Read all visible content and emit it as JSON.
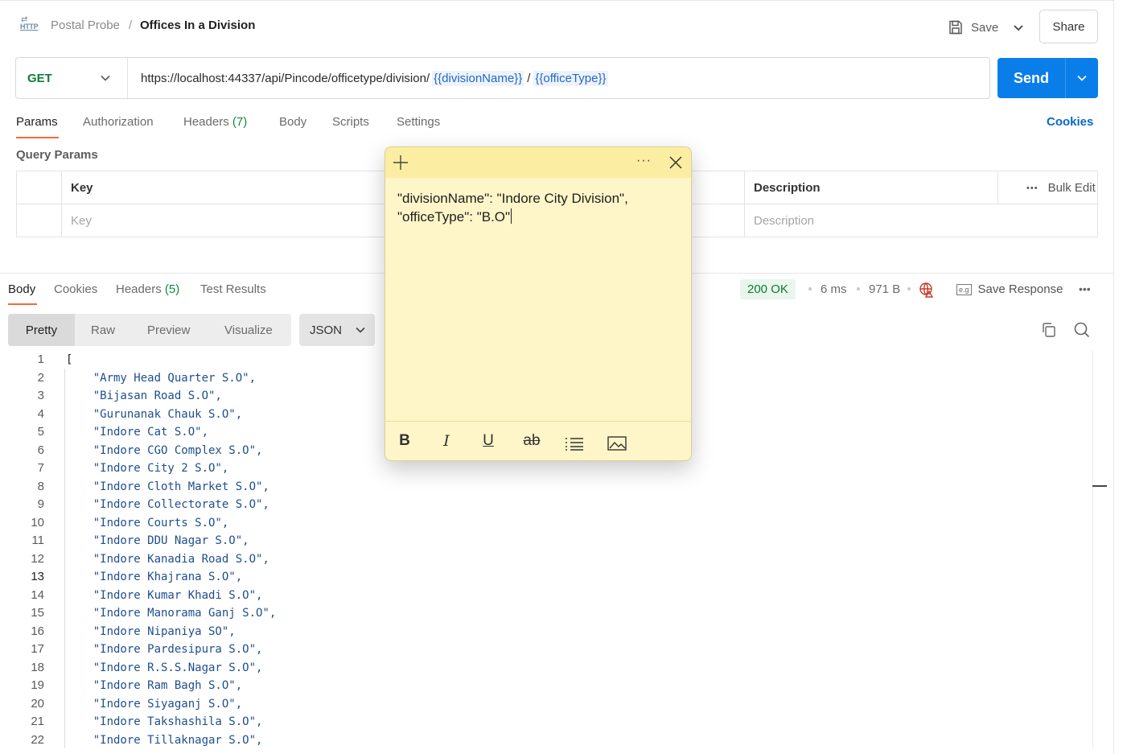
{
  "header": {
    "collection": "Postal Probe",
    "separator": "/",
    "request_name": "Offices In a Division",
    "save_label": "Save",
    "share_label": "Share"
  },
  "request": {
    "method": "GET",
    "url_base": "https://localhost:44337/api/Pincode/officetype/division/",
    "url_var1": "{{divisionName}}",
    "url_sep": "/",
    "url_var2": "{{officeType}}",
    "send_label": "Send"
  },
  "request_tabs": {
    "params": "Params",
    "authorization": "Authorization",
    "headers": "Headers",
    "headers_count": "(7)",
    "body": "Body",
    "scripts": "Scripts",
    "settings": "Settings",
    "cookies": "Cookies"
  },
  "query_params": {
    "title": "Query Params",
    "col_key": "Key",
    "col_description": "Description",
    "bulk_edit": "Bulk Edit",
    "key_placeholder": "Key",
    "description_placeholder": "Description"
  },
  "response": {
    "tabs": {
      "body": "Body",
      "cookies": "Cookies",
      "headers": "Headers",
      "headers_count": "(5)",
      "test_results": "Test Results"
    },
    "status": "200 OK",
    "time": "6 ms",
    "size": "971 B",
    "save_response": "Save Response",
    "view_modes": [
      "Pretty",
      "Raw",
      "Preview",
      "Visualize"
    ],
    "format": "JSON",
    "lines": [
      "[",
      "    \"Army Head Quarter S.O\",",
      "    \"Bijasan Road S.O\",",
      "    \"Gurunanak Chauk S.O\",",
      "    \"Indore Cat S.O\",",
      "    \"Indore CGO Complex S.O\",",
      "    \"Indore City 2 S.O\",",
      "    \"Indore Cloth Market S.O\",",
      "    \"Indore Collectorate S.O\",",
      "    \"Indore Courts S.O\",",
      "    \"Indore DDU Nagar S.O\",",
      "    \"Indore Kanadia Road S.O\",",
      "    \"Indore Khajrana S.O\",",
      "    \"Indore Kumar Khadi S.O\",",
      "    \"Indore Manorama Ganj S.O\",",
      "    \"Indore Nipaniya SO\",",
      "    \"Indore Pardesipura S.O\",",
      "    \"Indore R.S.S.Nagar S.O\",",
      "    \"Indore Ram Bagh S.O\",",
      "    \"Indore Siyaganj S.O\",",
      "    \"Indore Takshashila S.O\",",
      "    \"Indore Tillaknagar S.O\","
    ],
    "line_numbers": [
      "1",
      "2",
      "3",
      "4",
      "5",
      "6",
      "7",
      "8",
      "9",
      "10",
      "11",
      "12",
      "13",
      "14",
      "15",
      "16",
      "17",
      "18",
      "19",
      "20",
      "21",
      "22"
    ]
  },
  "sticky_note": {
    "line1": "\"divisionName\": \"Indore City Division\",",
    "line2": "\"officeType\": \"B.O\""
  },
  "colors": {
    "accent_orange": "#f26b3a",
    "send_blue": "#0a7ee8",
    "method_green": "#0d7d38",
    "note_yellow": "#fef6c8"
  }
}
